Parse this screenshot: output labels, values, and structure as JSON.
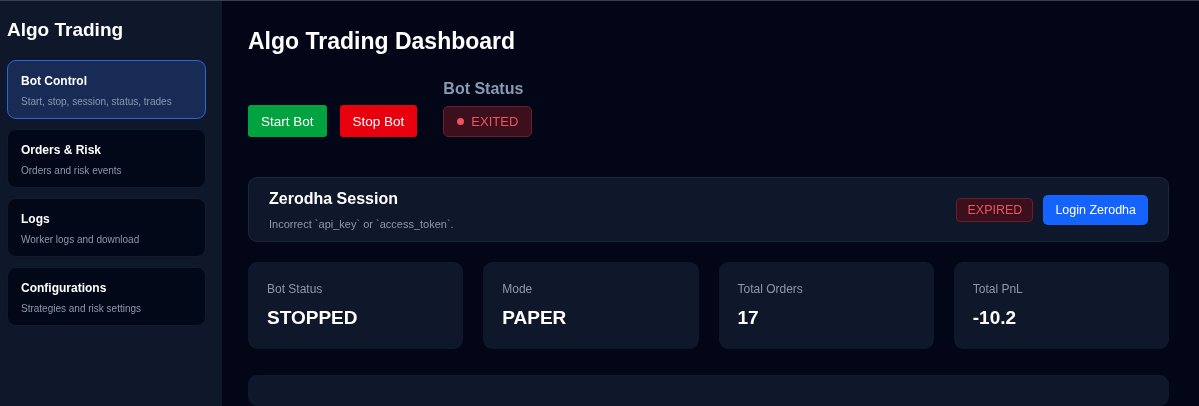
{
  "sidebar": {
    "title": "Algo Trading",
    "items": [
      {
        "label": "Bot Control",
        "description": "Start, stop, session, status, trades",
        "selected": true
      },
      {
        "label": "Orders & Risk",
        "description": "Orders and risk events",
        "selected": false
      },
      {
        "label": "Logs",
        "description": "Worker logs and download",
        "selected": false
      },
      {
        "label": "Configurations",
        "description": "Strategies and risk settings",
        "selected": false
      }
    ]
  },
  "page_title": "Algo Trading Dashboard",
  "controls": {
    "buttons": [
      {
        "label": "Start Bot",
        "kind": "start"
      },
      {
        "label": "Stop Bot",
        "kind": "stop"
      }
    ],
    "bot_status": {
      "heading": "Bot Status",
      "badge": "EXITED",
      "kind": "danger"
    }
  },
  "session": {
    "title": "Zerodha Session",
    "message": "Incorrect `api_key` or `access_token`.",
    "badge": {
      "text": "EXPIRED",
      "kind": "danger"
    },
    "button": "Login Zerodha"
  },
  "stats": [
    {
      "label": "Bot Status",
      "value": "STOPPED"
    },
    {
      "label": "Mode",
      "value": "PAPER"
    },
    {
      "label": "Total Orders",
      "value": "17"
    },
    {
      "label": "Total PnL",
      "value": "-10.2"
    }
  ]
}
